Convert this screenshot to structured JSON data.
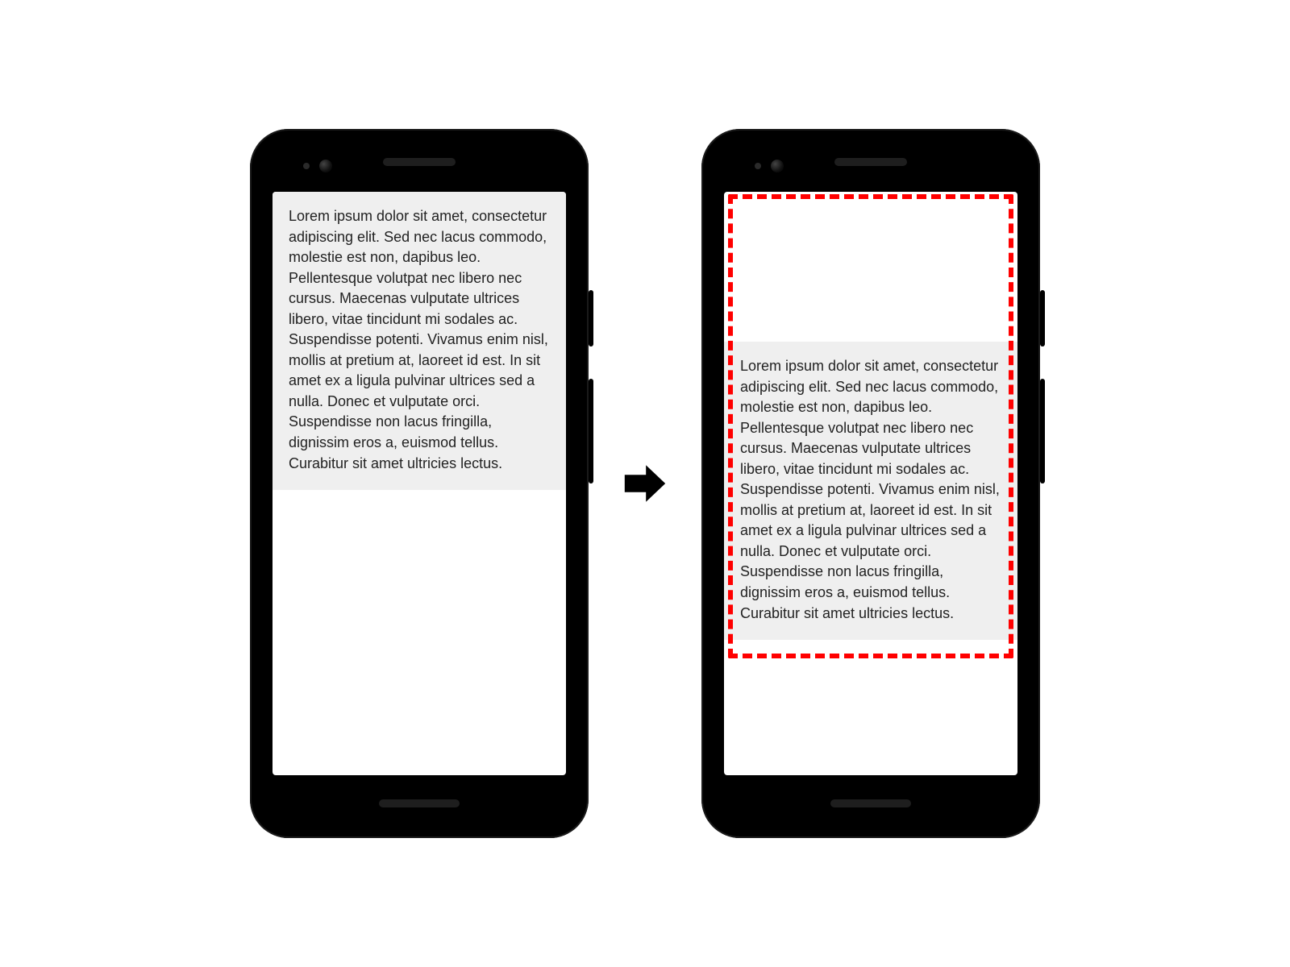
{
  "lorem": "Lorem ipsum dolor sit amet, consectetur adipiscing elit. Sed nec lacus commodo, molestie est non, dapibus leo. Pellentesque volutpat nec libero nec cursus. Maecenas vulputate ultrices libero, vitae tincidunt mi sodales ac. Suspendisse potenti. Vivamus enim nisl, mollis at pretium at, laoreet id est. In sit amet ex a ligula pulvinar ultrices sed a nulla. Donec et vulputate orci. Suspendisse non lacus fringilla, dignissim eros a, euismod tellus. Curabitur sit amet ultricies lectus.",
  "colors": {
    "accent_dash": "#ff0000",
    "text_bg": "#efefef"
  }
}
